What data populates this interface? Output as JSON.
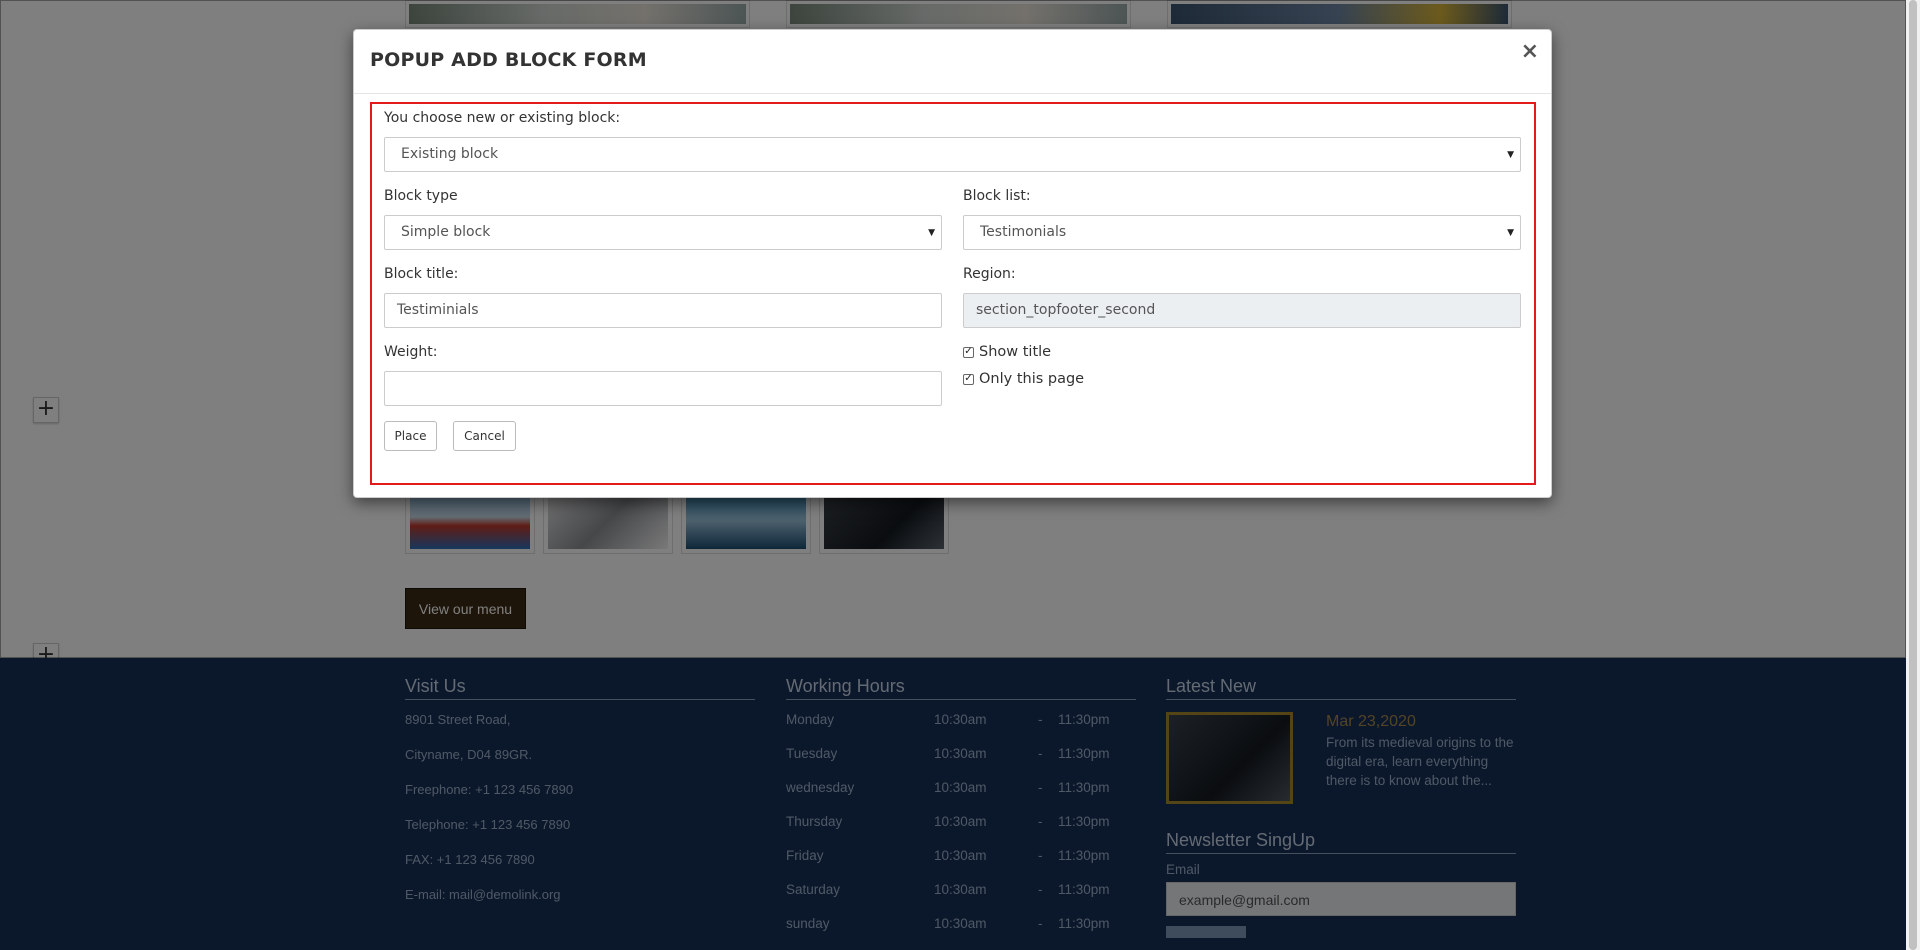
{
  "modal": {
    "title": "POPUP ADD BLOCK FORM",
    "close_glyph": "×",
    "choose_label": "You choose new or existing block:",
    "choose_value": "Existing block",
    "block_type_label": "Block type",
    "block_type_value": "Simple block",
    "block_list_label": "Block list:",
    "block_list_value": "Testimonials",
    "block_title_label": "Block title:",
    "block_title_value": "Testiminials",
    "region_label": "Region:",
    "region_value": "section_topfooter_second",
    "weight_label": "Weight:",
    "weight_value": "",
    "show_title_label": "Show title",
    "show_title_checked": true,
    "only_this_page_label": "Only this page",
    "only_this_page_checked": true,
    "place_label": "Place",
    "cancel_label": "Cancel",
    "caret_glyph": "▼"
  },
  "page": {
    "add_glyph": "+",
    "menu_button": "View our menu"
  },
  "footer": {
    "visit": {
      "title": "Visit Us",
      "lines": [
        "8901 Street Road,",
        "Cityname, D04 89GR.",
        "Freephone: +1 123 456 7890",
        "Telephone: +1 123 456 7890",
        "FAX: +1 123 456 7890",
        "E-mail: mail@demolink.org"
      ]
    },
    "hours": {
      "title": "Working Hours",
      "rows": [
        {
          "day": "Monday",
          "open": "10:30am",
          "sep": "-",
          "close": "11:30pm"
        },
        {
          "day": "Tuesday",
          "open": "10:30am",
          "sep": "-",
          "close": "11:30pm"
        },
        {
          "day": "wednesday",
          "open": "10:30am",
          "sep": "-",
          "close": "11:30pm"
        },
        {
          "day": "Thursday",
          "open": "10:30am",
          "sep": "-",
          "close": "11:30pm"
        },
        {
          "day": "Friday",
          "open": "10:30am",
          "sep": "-",
          "close": "11:30pm"
        },
        {
          "day": "Saturday",
          "open": "10:30am",
          "sep": "-",
          "close": "11:30pm"
        },
        {
          "day": "sunday",
          "open": "10:30am",
          "sep": "-",
          "close": "11:30pm"
        }
      ]
    },
    "news": {
      "title": "Latest New",
      "date": "Mar 23,2020",
      "excerpt": "From its medieval origins to the digital era, learn everything there is to know about the..."
    },
    "newsletter": {
      "title": "Newsletter SingUp",
      "email_label": "Email",
      "email_placeholder": "example@gmail.com"
    }
  },
  "colors": {
    "footer_bg": "#173057",
    "highlight_border": "#e31a1a",
    "menu_button_bg": "#3b2a13"
  }
}
